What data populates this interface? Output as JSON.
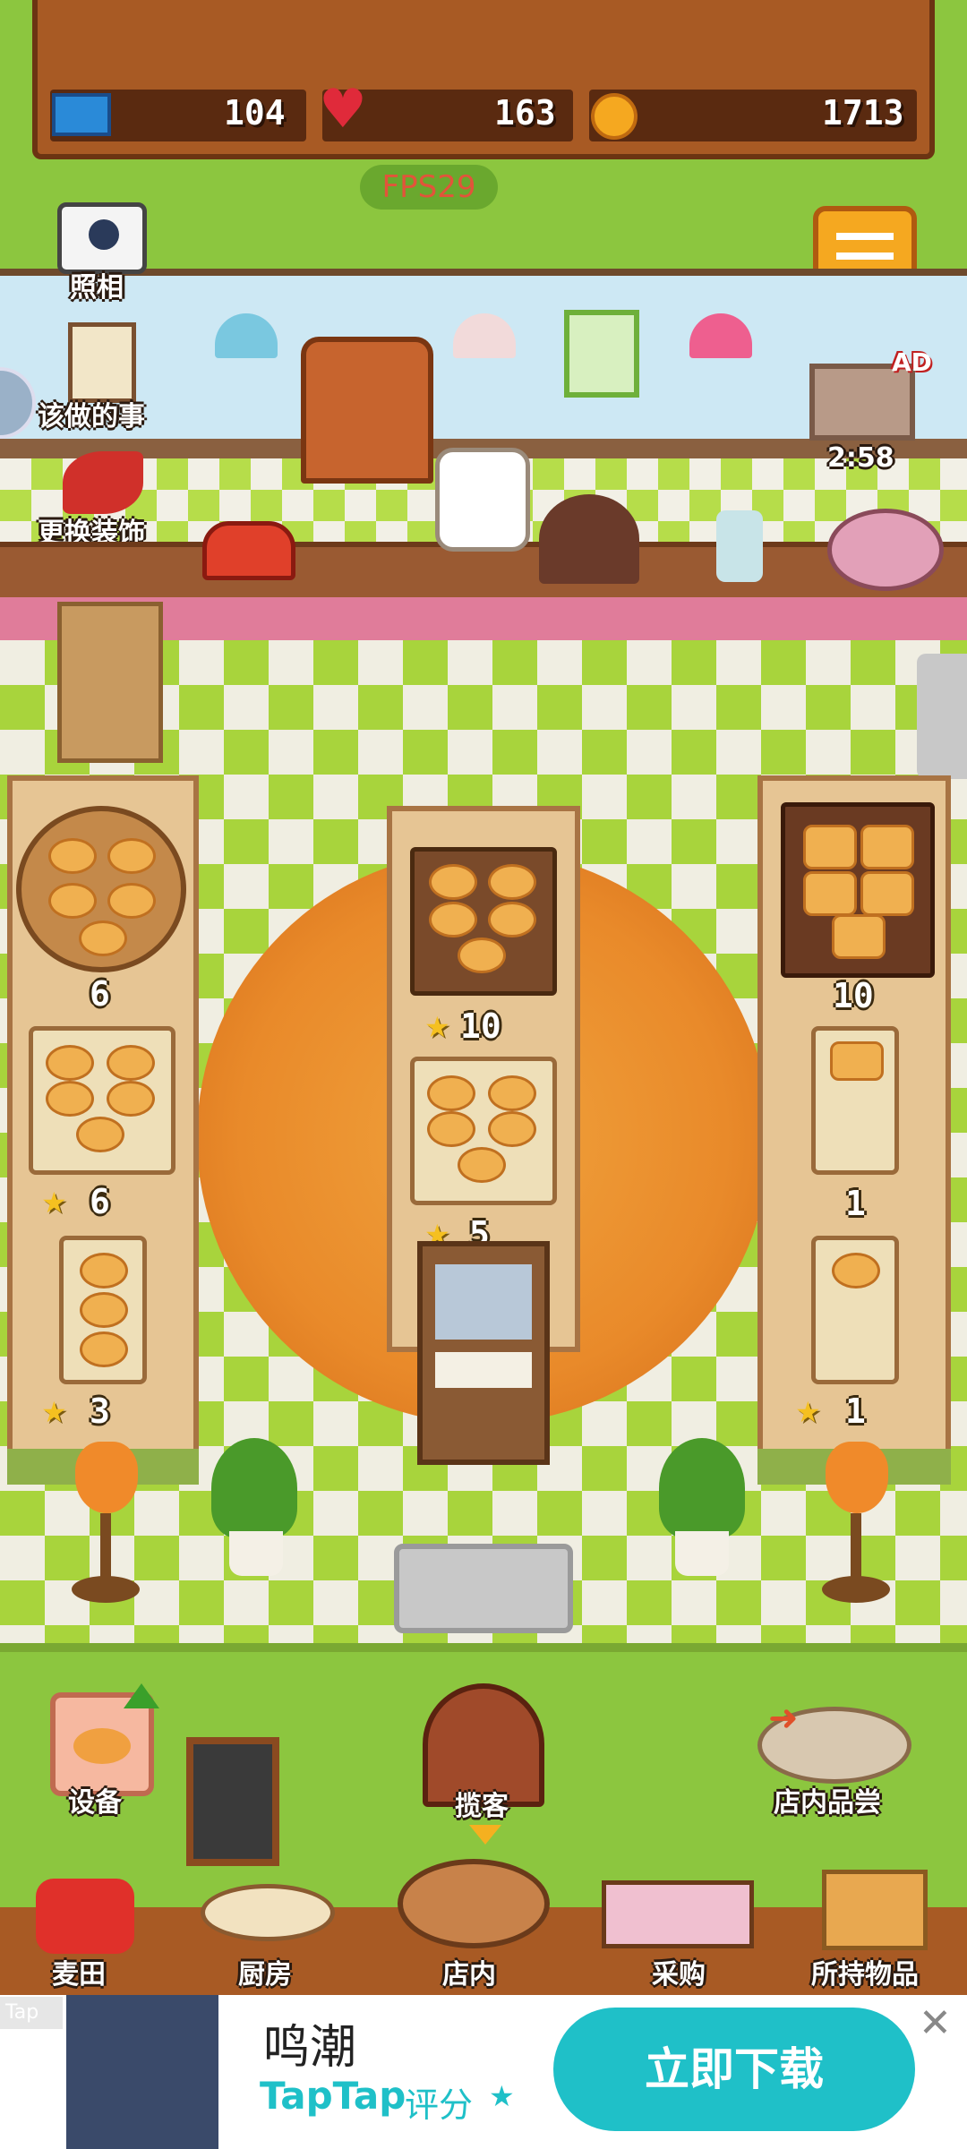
{
  "resources": {
    "tickets": "104",
    "hearts": "163",
    "coins": "1713"
  },
  "fps": "FPS29",
  "side_menu": {
    "photo": "照相",
    "todo": "该做的事",
    "decorate": "更换装饰"
  },
  "tv": {
    "ad_badge": "AD",
    "timer": "2:58"
  },
  "shelves": {
    "left": {
      "top": "6",
      "middle": "6",
      "bottom": "3"
    },
    "center": {
      "top": "10",
      "bottom": "5"
    },
    "right": {
      "top": "10",
      "middle": "1",
      "bottom": "1"
    }
  },
  "actions": {
    "equipment": "设备",
    "attract": "揽客",
    "tasting": "店内品尝"
  },
  "nav": {
    "items": [
      "麦田",
      "厨房",
      "店内",
      "采购",
      "所持物品"
    ]
  },
  "ad": {
    "tag": "Tap",
    "app_name": "鸣潮",
    "brand": "TapTap",
    "rating_label": "评分",
    "download": "立即下载"
  },
  "colors": {
    "grass": "#8cc63f",
    "wood": "#a85a24",
    "download_button": "#1fc0c8"
  }
}
